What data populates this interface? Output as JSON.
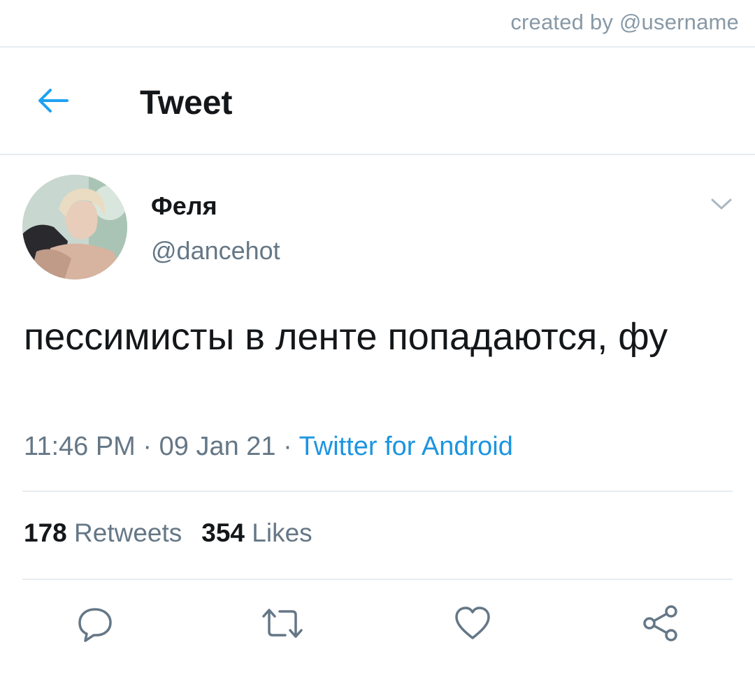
{
  "credit": "created by @username",
  "header": {
    "title": "Tweet",
    "back_icon": "arrow-left-icon",
    "accent": "#1da1f2"
  },
  "tweet": {
    "author": {
      "display_name": "Феля",
      "handle": "@dancehot"
    },
    "text": "пессимисты в ленте попадаются, фу",
    "time": "11:46 PM",
    "date": "09 Jan 21",
    "separator": " · ",
    "source": "Twitter for Android",
    "stats": {
      "retweets_count": "178",
      "retweets_label": "Retweets",
      "likes_count": "354",
      "likes_label": "Likes"
    },
    "actions": [
      {
        "icon": "reply-icon"
      },
      {
        "icon": "retweet-icon"
      },
      {
        "icon": "like-icon"
      },
      {
        "icon": "share-icon"
      }
    ]
  },
  "colors": {
    "text": "#14171a",
    "secondary": "#657786",
    "link": "#1b95e0",
    "divider": "#e6ecf0"
  }
}
